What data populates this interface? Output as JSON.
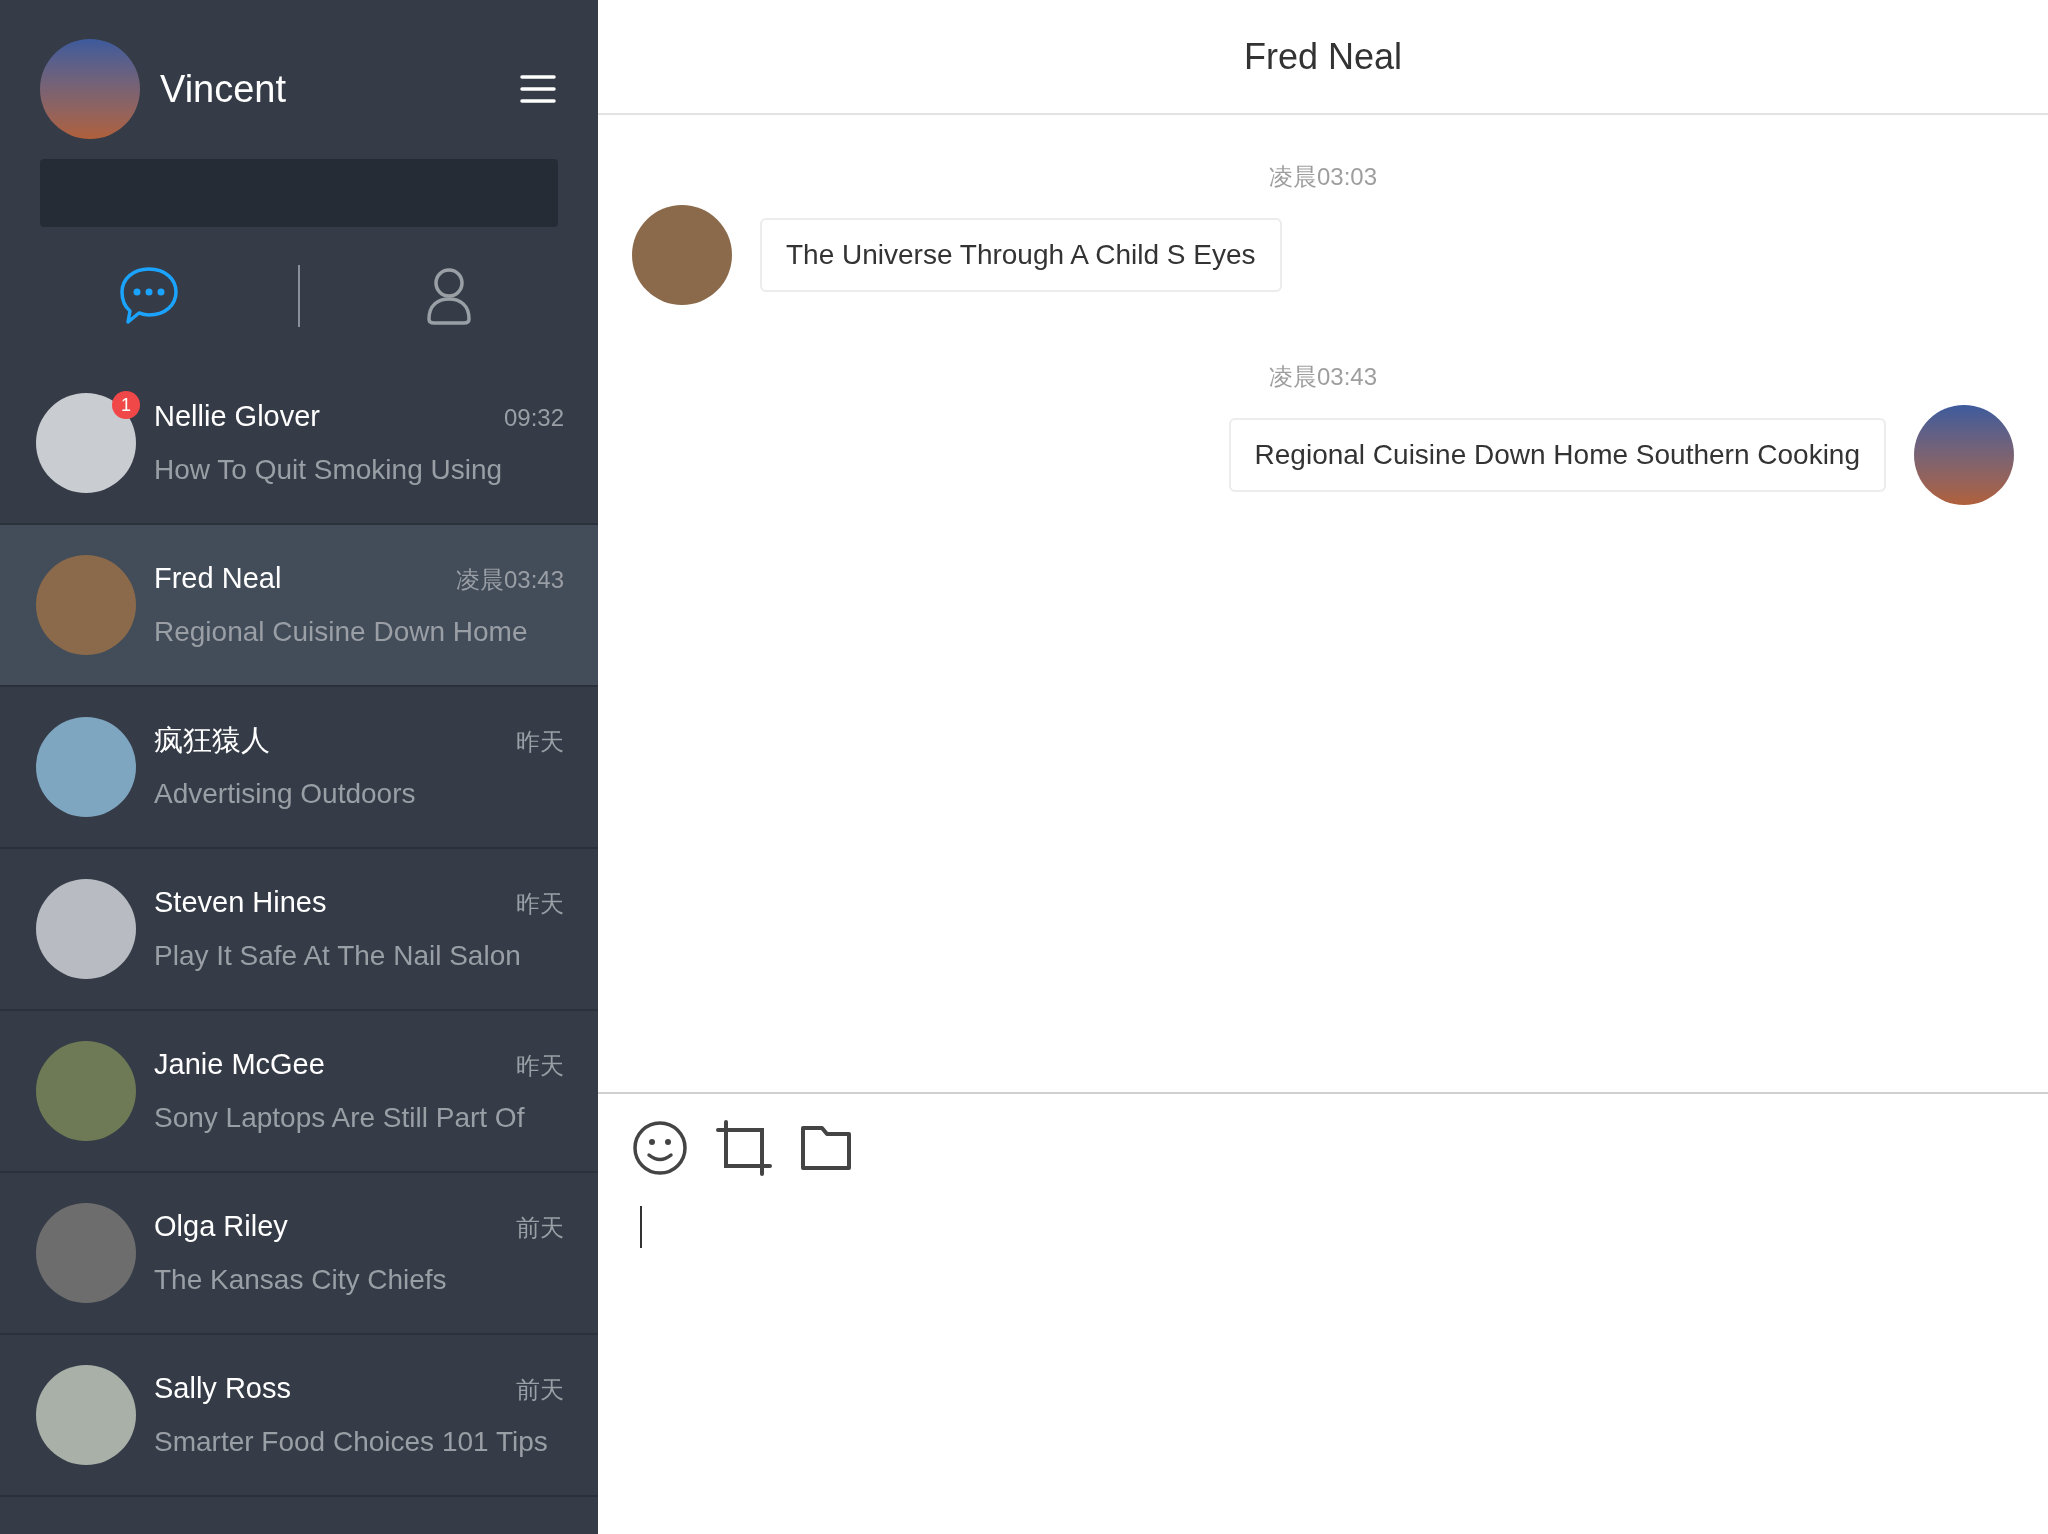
{
  "user": {
    "name": "Vincent"
  },
  "tabs": [
    {
      "kind": "chats",
      "selected": true
    },
    {
      "kind": "contacts",
      "selected": false
    }
  ],
  "conversations": [
    {
      "name": "Nellie Glover",
      "time": "09:32",
      "preview": "How To Quit Smoking Using",
      "badge": "1",
      "selected": false
    },
    {
      "name": "Fred Neal",
      "time": "凌晨03:43",
      "preview": "Regional Cuisine Down Home",
      "selected": true
    },
    {
      "name": "疯狂猿人",
      "time": "昨天",
      "preview": "Advertising Outdoors",
      "selected": false
    },
    {
      "name": "Steven Hines",
      "time": "昨天",
      "preview": "Play It Safe At The Nail Salon",
      "selected": false
    },
    {
      "name": "Janie McGee",
      "time": "昨天",
      "preview": "Sony Laptops Are Still Part Of",
      "selected": false
    },
    {
      "name": "Olga Riley",
      "time": "前天",
      "preview": "The Kansas City Chiefs",
      "selected": false
    },
    {
      "name": "Sally Ross",
      "time": "前天",
      "preview": "Smarter Food Choices 101 Tips",
      "selected": false
    }
  ],
  "chat": {
    "title": "Fred Neal",
    "messages": [
      {
        "time": "凌晨03:03",
        "text": "The Universe Through A Child S Eyes",
        "kind": "incoming"
      },
      {
        "time": "凌晨03:43",
        "text": "Regional Cuisine Down Home Southern Cooking",
        "kind": "outgoing"
      }
    ]
  }
}
